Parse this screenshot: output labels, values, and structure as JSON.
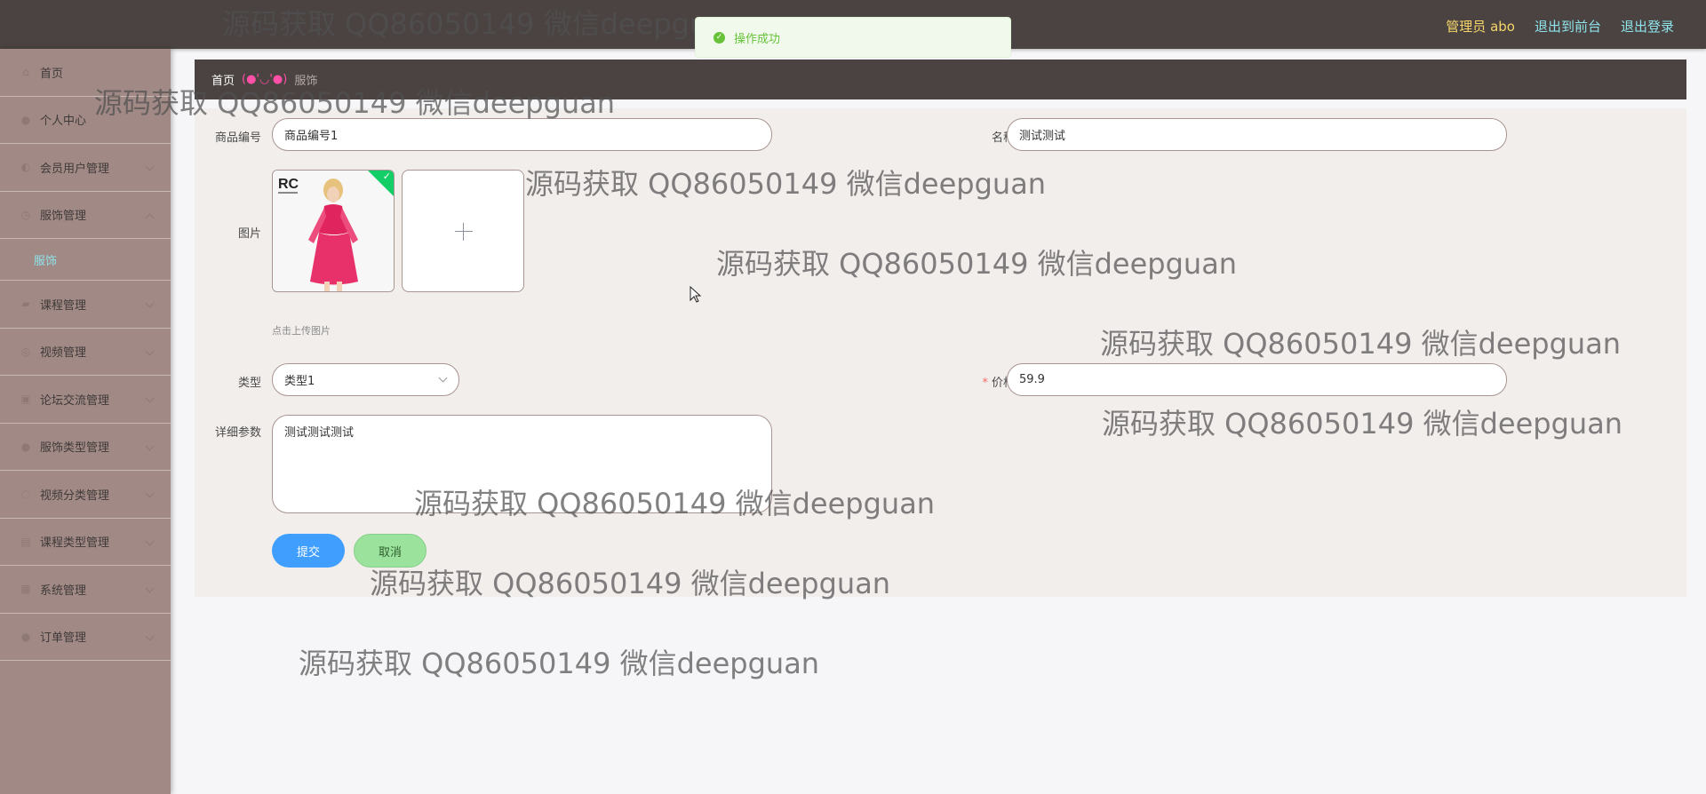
{
  "header": {
    "admin_label": "管理员 abo",
    "front_link": "退出到前台",
    "logout_link": "退出登录"
  },
  "toast": {
    "message": "操作成功"
  },
  "sidebar": {
    "items": [
      {
        "label": "首页",
        "icon": "home-icon"
      },
      {
        "label": "个人中心",
        "icon": "user-icon"
      },
      {
        "label": "会员用户管理",
        "icon": "users-icon"
      },
      {
        "label": "服饰管理",
        "icon": "clothing-icon"
      },
      {
        "label": "课程管理",
        "icon": "course-icon"
      },
      {
        "label": "视频管理",
        "icon": "video-icon"
      },
      {
        "label": "论坛交流管理",
        "icon": "forum-icon"
      },
      {
        "label": "服饰类型管理",
        "icon": "tag-icon"
      },
      {
        "label": "视频分类管理",
        "icon": "category-icon"
      },
      {
        "label": "课程类型管理",
        "icon": "list-icon"
      },
      {
        "label": "系统管理",
        "icon": "system-icon"
      },
      {
        "label": "订单管理",
        "icon": "order-icon"
      }
    ],
    "submenu": {
      "label": "服饰"
    }
  },
  "breadcrumb": {
    "home": "首页",
    "separator": "(●'◡'●)",
    "current": "服饰"
  },
  "form": {
    "code_label": "商品编号",
    "code_value": "商品编号1",
    "name_label": "名称",
    "name_value": "测试测试",
    "image_label": "图片",
    "upload_hint": "点击上传图片",
    "type_label": "类型",
    "type_value": "类型1",
    "price_label": "价格",
    "price_required": "*",
    "price_value": "59.9",
    "detail_label": "详细参数",
    "detail_value": "测试测试测试",
    "submit_label": "提交",
    "cancel_label": "取消"
  },
  "product_image": {
    "brand": "RC"
  },
  "watermark": {
    "text": "源码获取 QQ86050149 微信deepguan"
  },
  "colors": {
    "topbar": "#4a4341",
    "sidebar": "#a18985",
    "accent_cyan": "#8fe3ea",
    "accent_yellow": "#f6d66b",
    "submit": "#409eff",
    "cancel": "#9be39c",
    "success": "#67c23a"
  }
}
